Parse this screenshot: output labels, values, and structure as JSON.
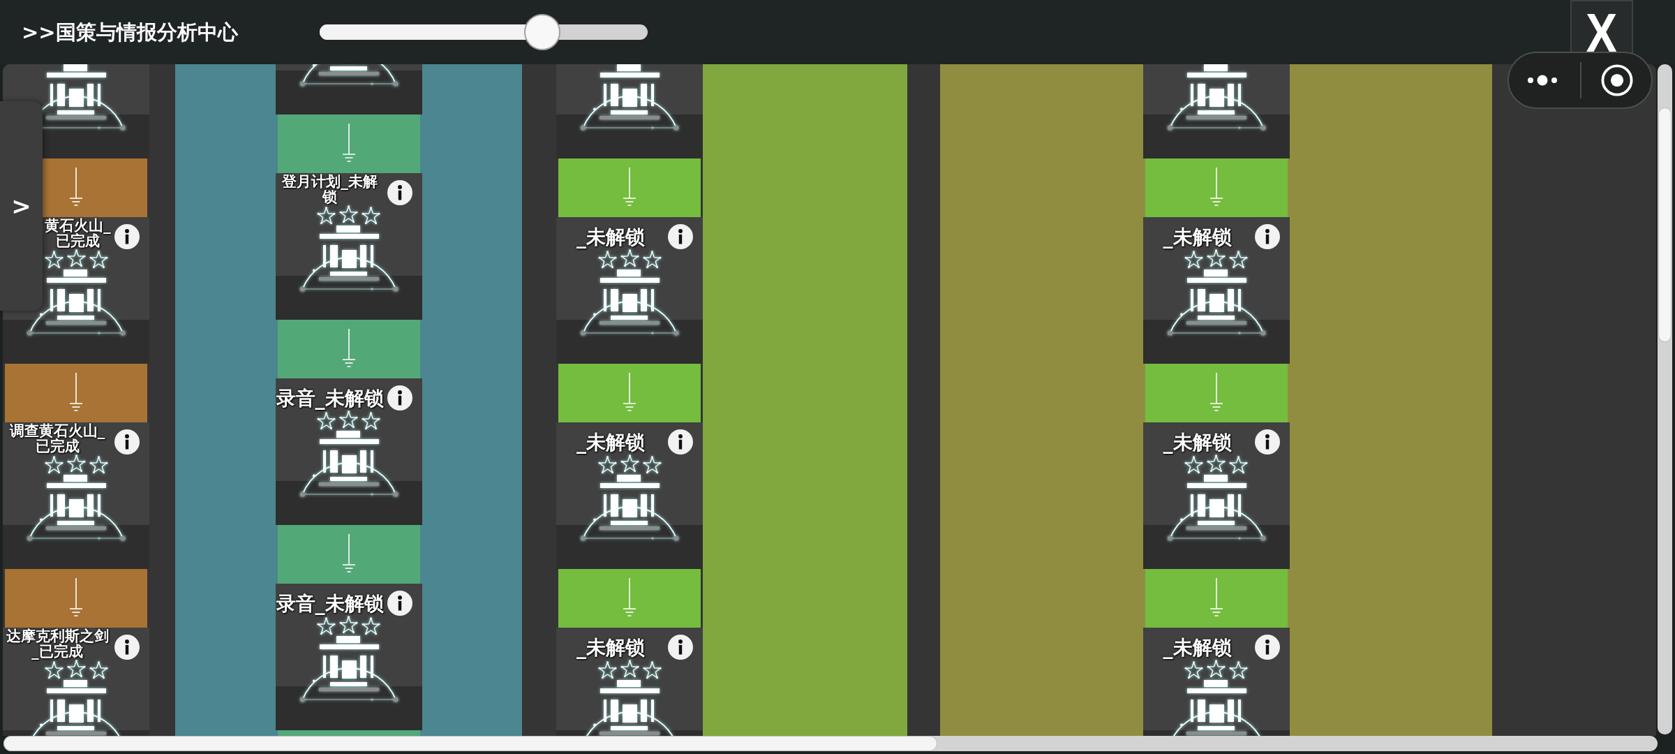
{
  "top_bar": {
    "title": ">>国策与情报分析中心",
    "slider": {
      "level": 0.68
    },
    "close_button": "X"
  },
  "drawer": {
    "toggle": ">"
  },
  "lanes": [
    {
      "items": [
        {
          "kind": "node"
        },
        {
          "kind": "link",
          "color": "#a87334"
        },
        {
          "kind": "node",
          "title": "黄石火山_已完成"
        },
        {
          "kind": "link",
          "color": "#a87334"
        },
        {
          "kind": "node",
          "title": "调查黄石火山_已完成"
        },
        {
          "kind": "link",
          "color": "#a87334"
        },
        {
          "kind": "node",
          "title": "达摩克利斯之剑_已完成"
        }
      ]
    },
    {
      "color": "#4b8691",
      "items": [
        {
          "kind": "node"
        },
        {
          "kind": "link",
          "color": "#53a878"
        },
        {
          "kind": "node",
          "title": "登月计划_未解锁"
        },
        {
          "kind": "link",
          "color": "#53a878"
        },
        {
          "kind": "node",
          "title": "录音_未解锁"
        },
        {
          "kind": "link",
          "color": "#53a878"
        },
        {
          "kind": "node",
          "title": "录音_未解锁"
        },
        {
          "kind": "link",
          "color": "#53a878"
        }
      ]
    },
    {
      "items": [
        {
          "kind": "node"
        },
        {
          "kind": "link",
          "color": "#74bd3e"
        },
        {
          "kind": "node",
          "title": "_未解锁"
        },
        {
          "kind": "link",
          "color": "#74bd3e"
        },
        {
          "kind": "node",
          "title": "_未解锁"
        },
        {
          "kind": "link",
          "color": "#74bd3e"
        },
        {
          "kind": "node",
          "title": "_未解锁"
        }
      ]
    },
    {
      "color": "#80a83e"
    },
    {
      "color": "#918d40",
      "items": [
        {
          "kind": "node"
        },
        {
          "kind": "link",
          "color": "#74bd3e"
        },
        {
          "kind": "node",
          "title": "_未解锁"
        },
        {
          "kind": "link",
          "color": "#74bd3e"
        },
        {
          "kind": "node",
          "title": "_未解锁"
        },
        {
          "kind": "link",
          "color": "#74bd3e"
        },
        {
          "kind": "node",
          "title": "_未解锁"
        }
      ]
    }
  ]
}
